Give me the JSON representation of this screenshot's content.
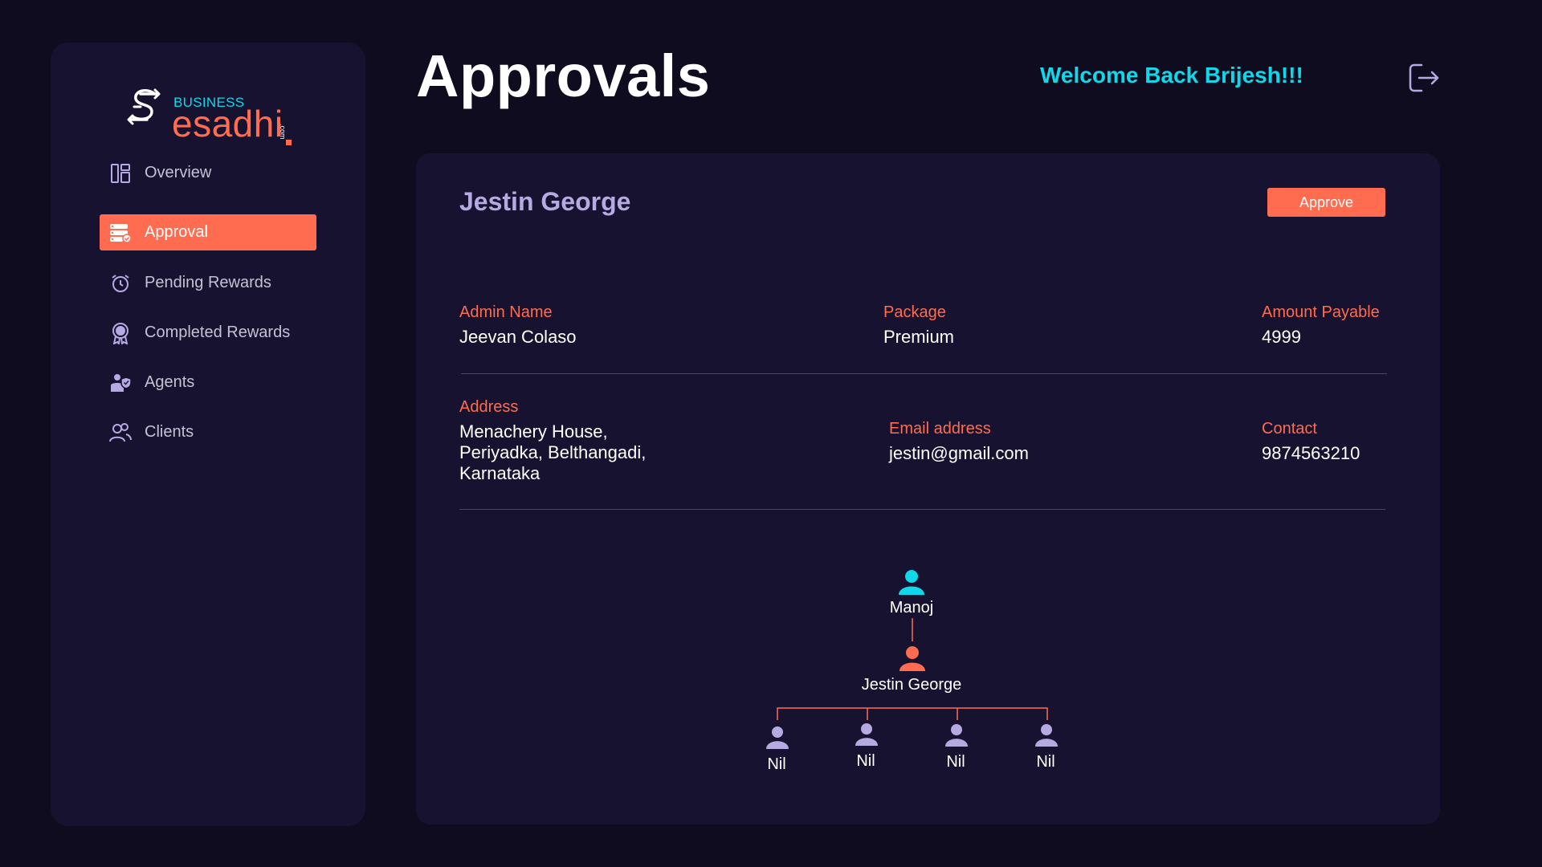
{
  "brand": {
    "business": "BUSINESS",
    "name": "esadhi",
    "suffix": ".com",
    "colors": {
      "accent": "#ff6c50",
      "teal": "#11d8e8"
    }
  },
  "sidebar": {
    "items": [
      {
        "label": "Overview",
        "icon": "dashboard-icon",
        "active": false
      },
      {
        "label": "Approval",
        "icon": "approval-list-icon",
        "active": true
      },
      {
        "label": "Pending Rewards",
        "icon": "alarm-clock-icon",
        "active": false
      },
      {
        "label": "Completed Rewards",
        "icon": "award-badge-icon",
        "active": false
      },
      {
        "label": "Agents",
        "icon": "agent-shield-icon",
        "active": false
      },
      {
        "label": "Clients",
        "icon": "users-icon",
        "active": false
      }
    ]
  },
  "header": {
    "title": "Approvals",
    "welcome": "Welcome Back Brijesh!!!",
    "logout_icon": "logout-icon"
  },
  "detail": {
    "name": "Jestin George",
    "approve_label": "Approve",
    "admin_name": {
      "label": "Admin Name",
      "value": "Jeevan Colaso"
    },
    "package": {
      "label": "Package",
      "value": "Premium"
    },
    "amount": {
      "label": "Amount Payable",
      "value": "4999"
    },
    "address": {
      "label": "Address",
      "lines": [
        "Menachery House,",
        "Periyadka, Belthangadi,",
        "Karnataka"
      ]
    },
    "email": {
      "label": "Email address",
      "value": "jestin@gmail.com"
    },
    "contact": {
      "label": "Contact",
      "value": "9874563210"
    }
  },
  "tree": {
    "parent": {
      "name": "Manoj",
      "color": "#11d8e8"
    },
    "self": {
      "name": "Jestin George",
      "color": "#ff6c50"
    },
    "children": [
      {
        "name": "Nil",
        "color": "#b7a9e2"
      },
      {
        "name": "Nil",
        "color": "#b7a9e2"
      },
      {
        "name": "Nil",
        "color": "#b7a9e2"
      },
      {
        "name": "Nil",
        "color": "#b7a9e2"
      }
    ]
  }
}
